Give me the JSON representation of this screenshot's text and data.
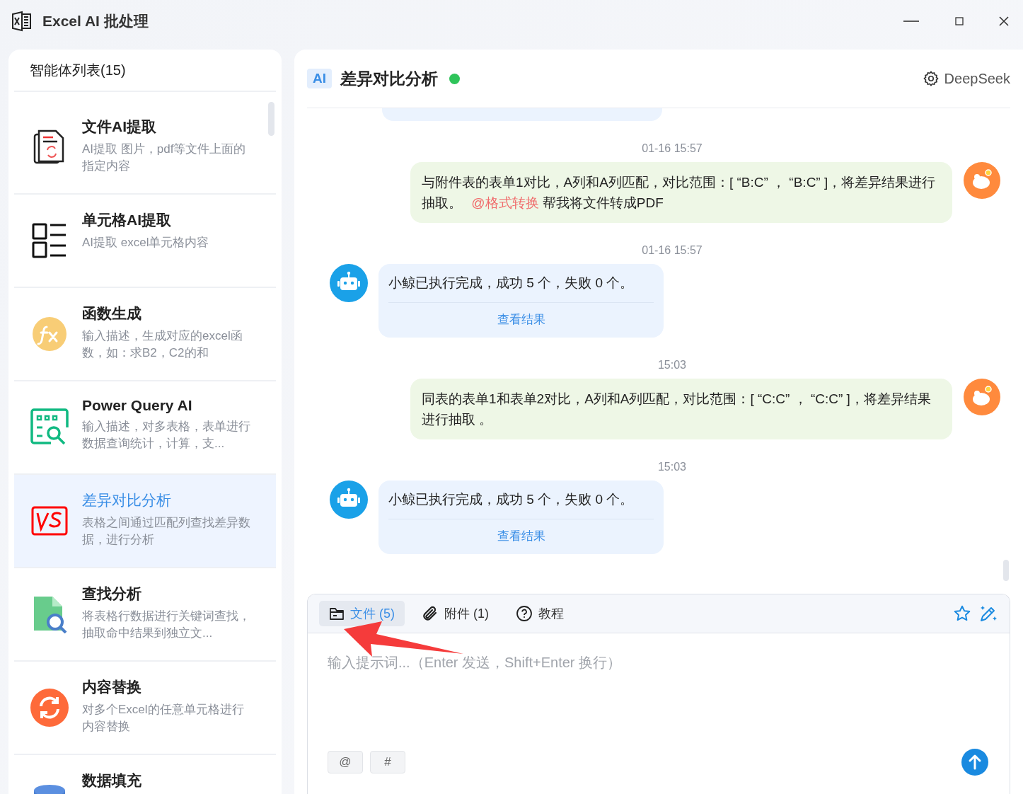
{
  "window": {
    "title": "Excel AI 批处理"
  },
  "sidebar": {
    "title": "智能体列表(15)",
    "items": [
      {
        "kind": "file-extract",
        "title": "文件AI提取",
        "description": "AI提取 图片，pdf等文件上面的指定内容",
        "selected": false
      },
      {
        "kind": "cell",
        "title": "单元格AI提取",
        "description": "AI提取 excel单元格内容",
        "selected": false
      },
      {
        "kind": "function",
        "title": "函数生成",
        "description": "输入描述，生成对应的excel函数，如：求B2，C2的和",
        "selected": false
      },
      {
        "kind": "power-query",
        "title": "Power Query AI",
        "description": "输入描述，对多表格，表单进行数据查询统计，计算，支...",
        "selected": false
      },
      {
        "kind": "vs",
        "title": "差异对比分析",
        "description": "表格之间通过匹配列查找差异数据，进行分析",
        "selected": true
      },
      {
        "kind": "search",
        "title": "查找分析",
        "description": "将表格行数据进行关键词查找，抽取命中结果到独立文...",
        "selected": false
      },
      {
        "kind": "replace",
        "title": "内容替换",
        "description": "对多个Excel的任意单元格进行内容替换",
        "selected": false
      },
      {
        "kind": "database",
        "title": "数据填充",
        "selected": false
      }
    ]
  },
  "chat": {
    "badge": "AI",
    "title": "差异对比分析",
    "online": true,
    "model": "DeepSeek",
    "messages": [
      {
        "kind": "cut"
      },
      {
        "kind": "time",
        "text": "01-16 15:57"
      },
      {
        "kind": "user",
        "text": "与附件表的表单1对比，A列和A列匹配，对比范围：[ “B:C” ， “B:C” ]，将差异结果进行抽取。 ",
        "mention": "@格式转换",
        "after": " 帮我将文件转成PDF"
      },
      {
        "kind": "time",
        "text": "01-16 15:57"
      },
      {
        "kind": "bot",
        "text": "小鲸已执行完成，成功 5 个，失败 0 个。",
        "link": "查看结果"
      },
      {
        "kind": "time",
        "text": "15:03"
      },
      {
        "kind": "user",
        "text": "同表的表单1和表单2对比，A列和A列匹配，对比范围：[ “C:C” ， “C:C” ]，将差异结果进行抽取 。"
      },
      {
        "kind": "time",
        "text": "15:03"
      },
      {
        "kind": "bot",
        "text": "小鲸已执行完成，成功 5 个，失败 0 个。",
        "link": "查看结果"
      }
    ]
  },
  "composer": {
    "tabs": [
      {
        "kind": "folder",
        "label": "文件 (5)",
        "selected": true
      },
      {
        "kind": "clip",
        "label": "附件 (1)",
        "selected": false
      },
      {
        "kind": "help",
        "label": "教程",
        "selected": false
      }
    ],
    "placeholder": "输入提示词...（Enter 发送，Shift+Enter 换行）",
    "chips": [
      "@",
      "#"
    ]
  }
}
